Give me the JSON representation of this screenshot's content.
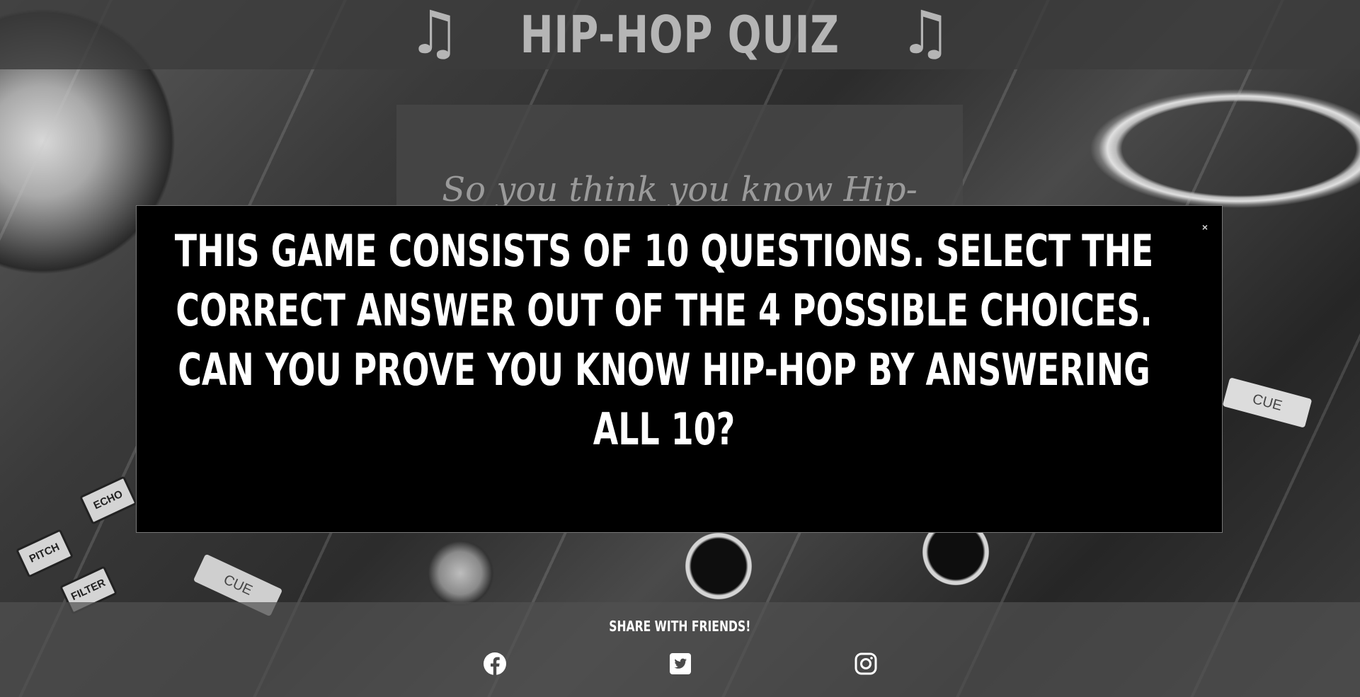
{
  "header": {
    "title": "HIP-HOP QUIZ",
    "left_icon": "music-note-icon",
    "right_icon": "music-note-icon"
  },
  "intro": {
    "text": "So you think you know Hip-"
  },
  "modal": {
    "close_label": "×",
    "instructions": "THIS GAME CONSISTS OF 10 QUESTIONS. SELECT THE CORRECT ANSWER OUT OF THE 4 POSSIBLE CHOICES. CAN YOU PROVE YOU KNOW HIP-HOP BY ANSWERING ALL 10?"
  },
  "background": {
    "cue_right": "CUE",
    "cue_left": "CUE",
    "fx_echo": "ECHO",
    "fx_pitch": "PITCH",
    "fx_filter": "FILTER"
  },
  "footer": {
    "share_label": "SHARE WITH FRIENDS!",
    "social": [
      {
        "name": "facebook",
        "icon": "facebook-icon"
      },
      {
        "name": "twitter",
        "icon": "twitter-icon"
      },
      {
        "name": "instagram",
        "icon": "instagram-icon"
      }
    ]
  },
  "colors": {
    "header_text": "#b5b5b5",
    "modal_bg": "#000000",
    "modal_text": "#ffffff"
  }
}
